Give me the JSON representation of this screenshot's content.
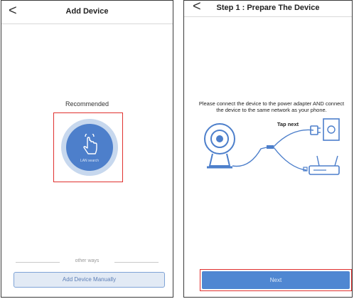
{
  "left_screen": {
    "title": "Add Device",
    "back_label": "<",
    "recommended_label": "Recommended",
    "lan_search_label": "LAN search",
    "other_ways_label": "other ways",
    "add_manually_label": "Add Device Manually"
  },
  "right_screen": {
    "title": "Step 1 : Prepare The Device",
    "back_label": "<",
    "instruction": "Please connect the device to the power adapter AND connect the device to the same network as your phone.",
    "tap_next": "Tap next",
    "next_label": "Next"
  },
  "colors": {
    "accent_blue": "#4d7fcb",
    "highlight_red": "#e0312f"
  }
}
